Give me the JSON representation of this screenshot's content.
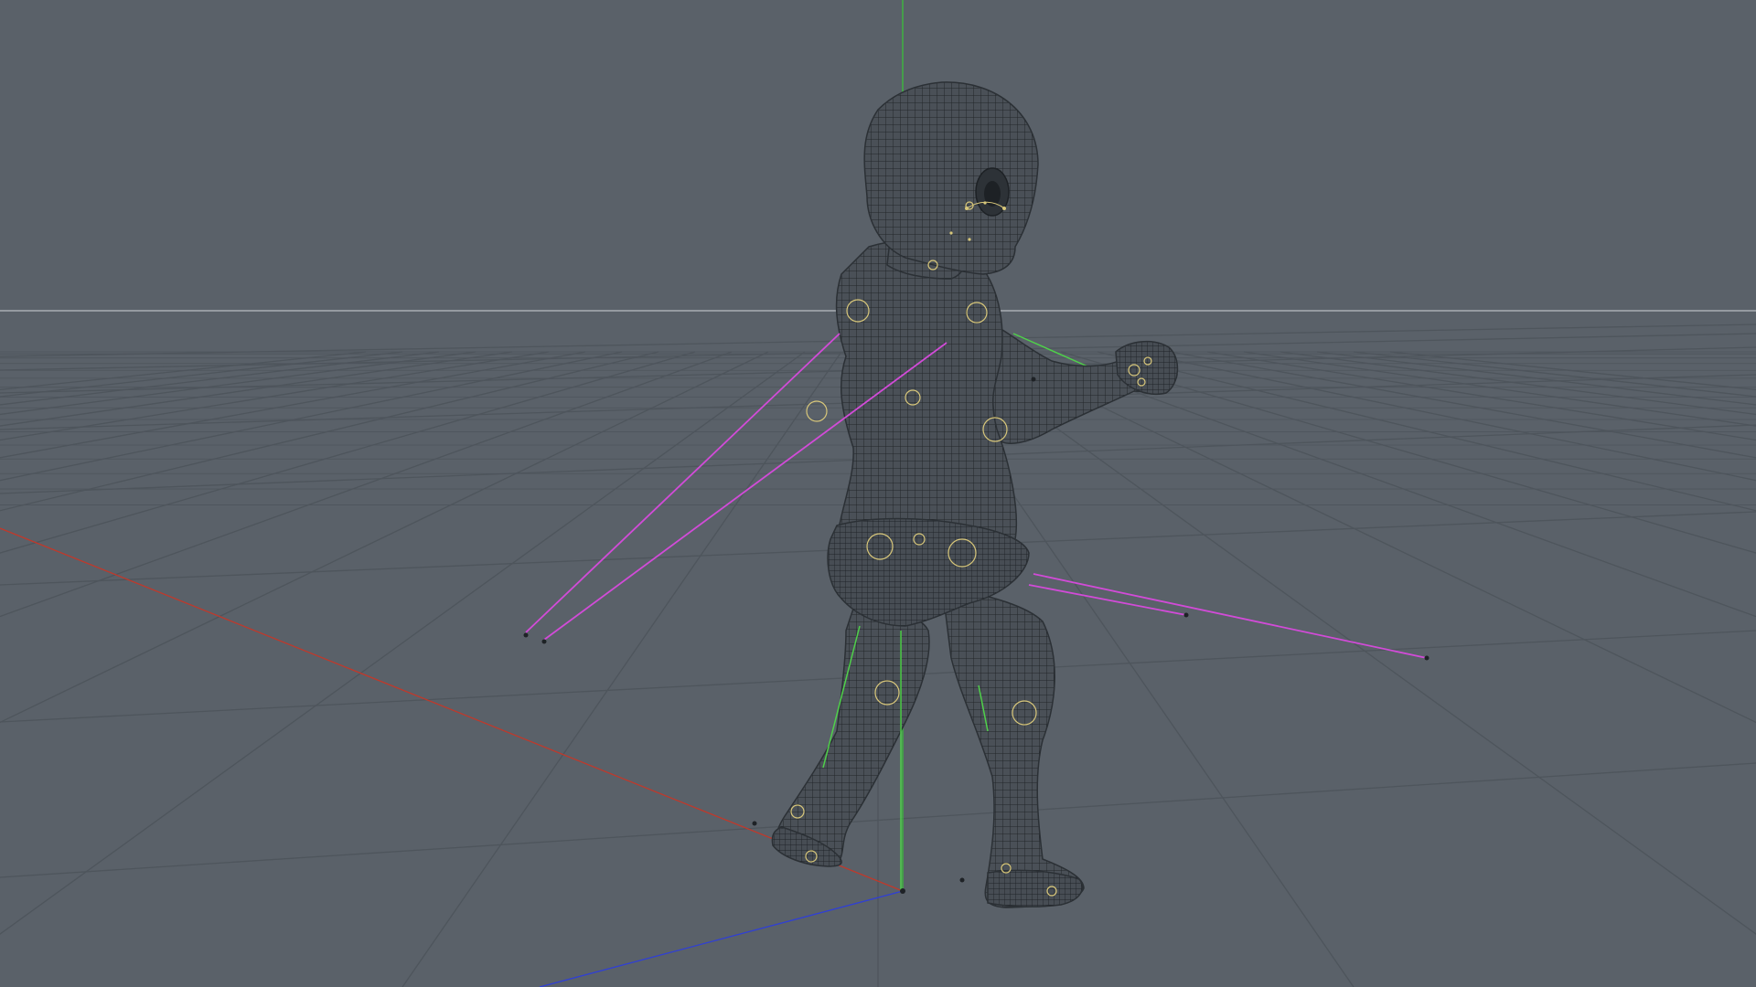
{
  "viewport": {
    "background_color": "#5a6169",
    "grid_color": "#4e555c",
    "horizon_color": "#b9bec3",
    "axis_colors": {
      "x": "#c0392b",
      "y": "#3bbf3b",
      "z": "#2f3fd6"
    },
    "mesh": {
      "subject": "toddler-figure",
      "fill_color": "#4a5057",
      "wire_color": "#22262a"
    },
    "rig": {
      "ik_line_color": "#d24bd8",
      "bone_line_color": "#4fd14a",
      "joint_color": "#d8c77a"
    }
  }
}
